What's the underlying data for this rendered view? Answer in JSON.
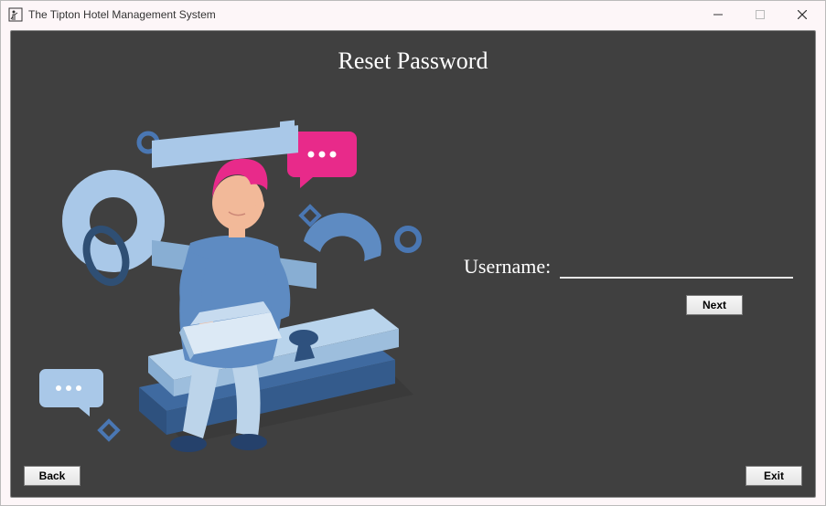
{
  "window": {
    "title": "The Tipton Hotel Management System",
    "controls": {
      "minimize": "minimize",
      "maximize": "maximize",
      "close": "close"
    }
  },
  "page": {
    "title": "Reset Password"
  },
  "form": {
    "username_label": "Username:",
    "username_value": "",
    "next_label": "Next"
  },
  "footer": {
    "back_label": "Back",
    "exit_label": "Exit"
  },
  "illustration": {
    "name": "person-laptop-padlock-keys"
  }
}
